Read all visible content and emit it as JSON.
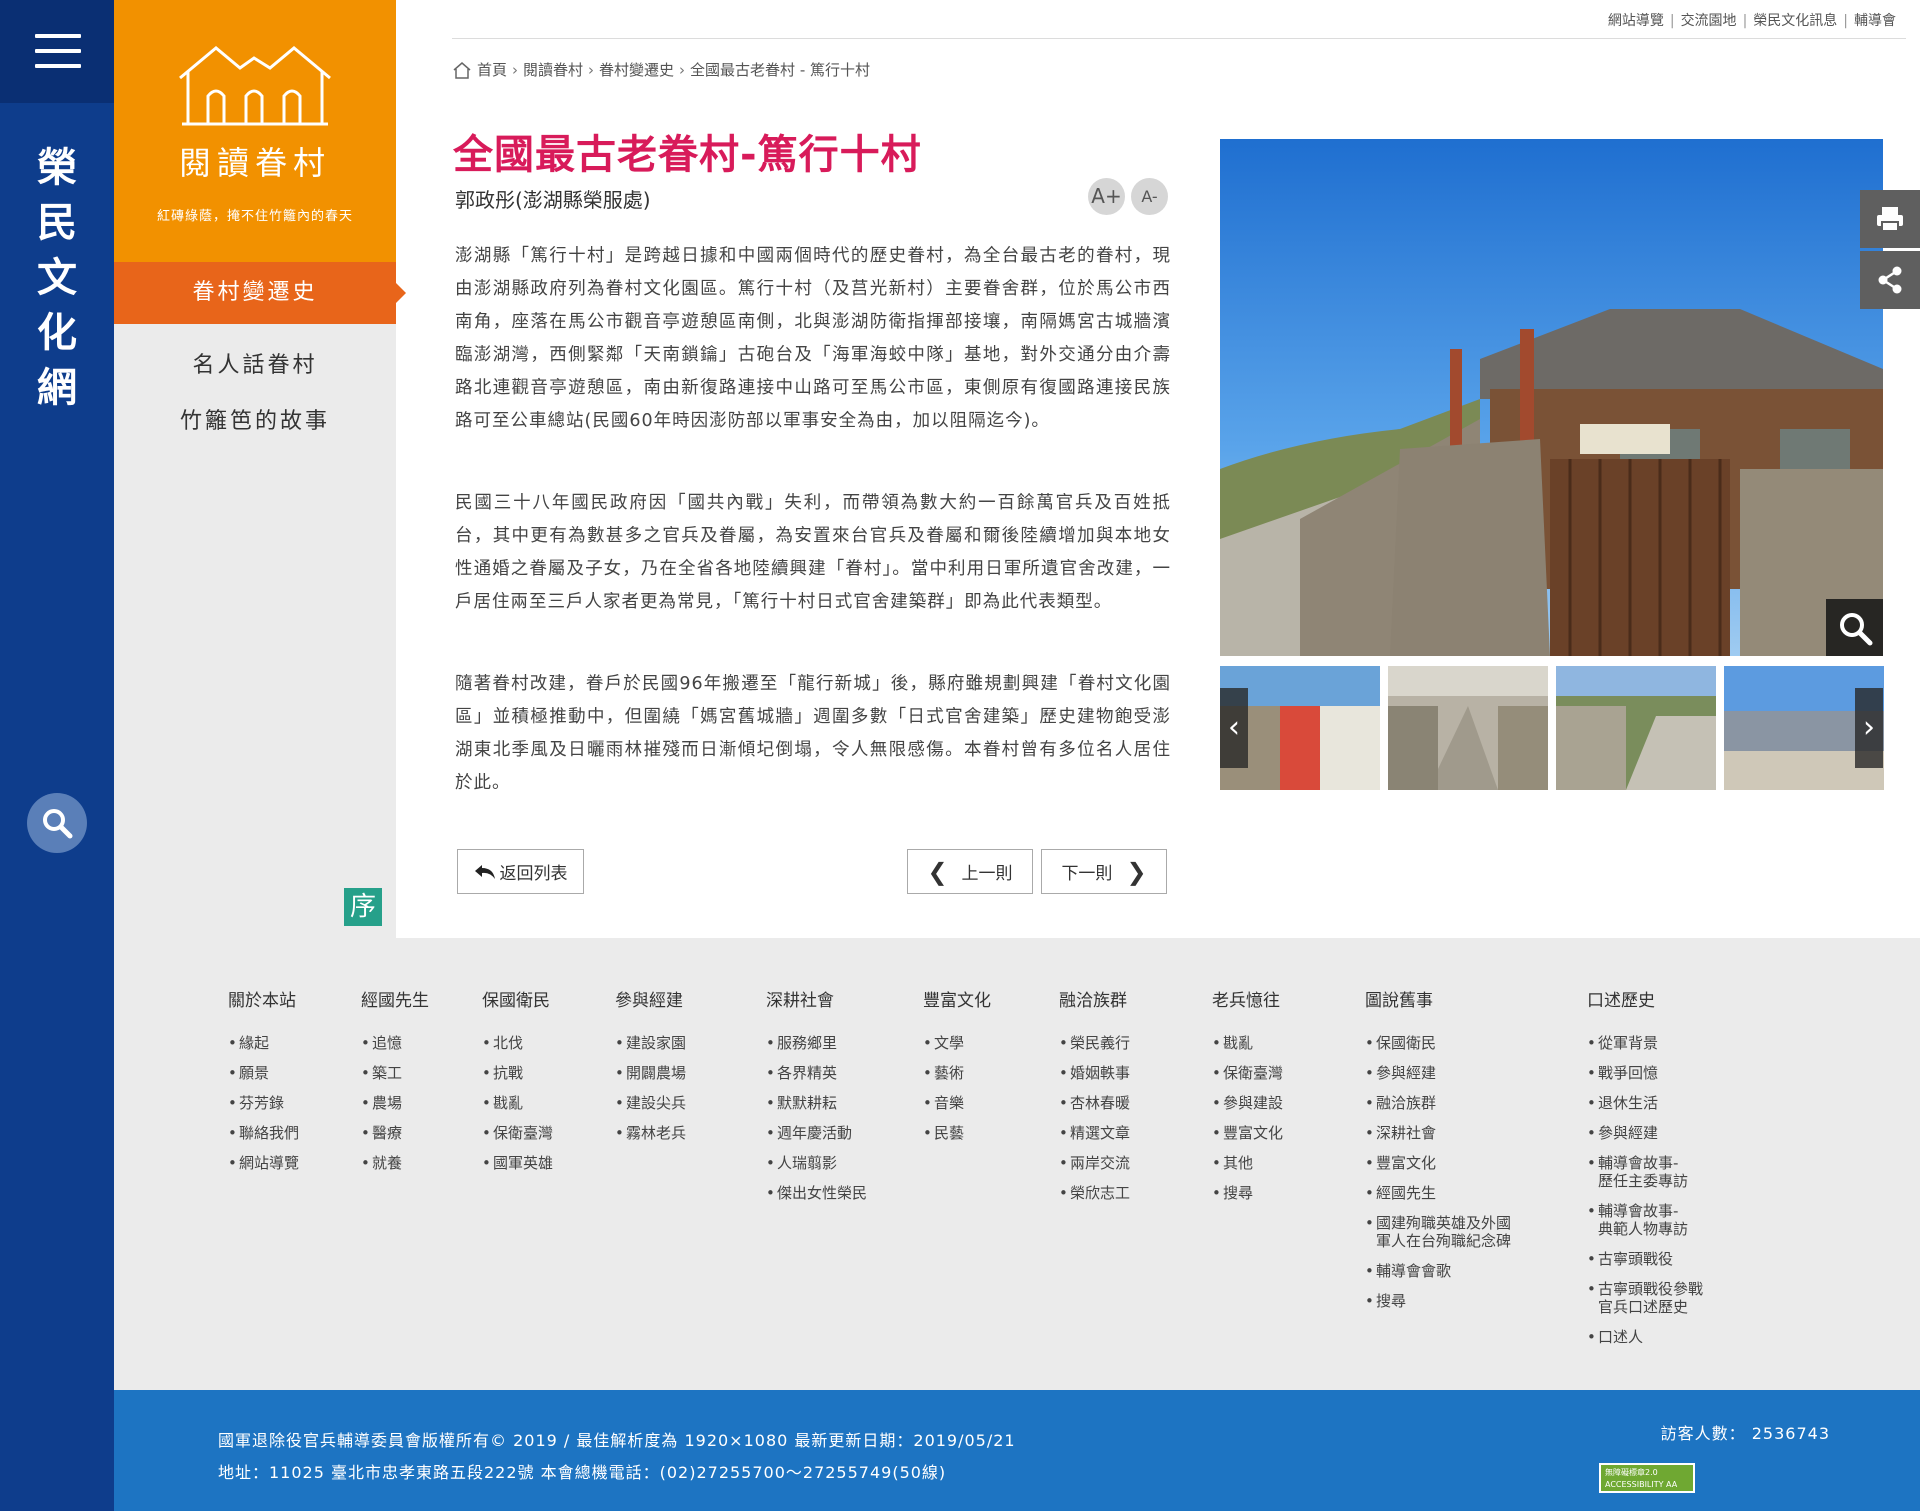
{
  "site": {
    "name": [
      "榮",
      "民",
      "文",
      "化",
      "網"
    ]
  },
  "sidebar": {
    "title": "閱讀眷村",
    "subtitle": "紅磚綠蔭，掩不住竹籬內的春天",
    "active": "眷村變遷史",
    "items": [
      "名人話眷村",
      "竹籬笆的故事"
    ],
    "badge": "序"
  },
  "toplinks": [
    "網站導覽",
    "交流園地",
    "榮民文化訊息",
    "輔導會"
  ],
  "breadcrumb": [
    "首頁",
    "閱讀眷村",
    "眷村變遷史",
    "全國最古老眷村 - 篤行十村"
  ],
  "article": {
    "title": "全國最古老眷村-篤行十村",
    "author": "郭政彤(澎湖縣榮服處)",
    "font_up": "A+",
    "font_down": "A-",
    "paragraphs": [
      "澎湖縣「篤行十村」是跨越日據和中國兩個時代的歷史眷村，為全台最古老的眷村，現由澎湖縣政府列為眷村文化園區。篤行十村（及莒光新村）主要眷舍群，位於馬公市西南角，座落在馬公市觀音亭遊憩區南側，北與澎湖防衛指揮部接壤，南隔媽宮古城牆濱臨澎湖灣，西側緊鄰「天南鎖鑰」古砲台及「海軍海蛟中隊」基地，對外交通分由介壽路北連觀音亭遊憩區，南由新復路連接中山路可至馬公市區，東側原有復國路連接民族路可至公車總站(民國60年時因澎防部以軍事安全為由，加以阻隔迄今)。",
      "民國三十八年國民政府因「國共內戰」失利，而帶領為數大約一百餘萬官兵及百姓抵台，其中更有為數甚多之官兵及眷屬，為安置來台官兵及眷屬和爾後陸續增加與本地女性通婚之眷屬及子女，乃在全省各地陸續興建「眷村」。當中利用日軍所遺官舍改建，一戶居住兩至三戶人家者更為常見，「篤行十村日式官舍建築群」即為此代表類型。",
      "隨著眷村改建，眷戶於民國96年搬遷至「龍行新城」後，縣府雖規劃興建「眷村文化園區」並積極推動中，但圍繞「媽宮舊城牆」週圍多數「日式官舍建築」歷史建物飽受澎湖東北季風及日曬雨林摧殘而日漸傾圮倒塌，令人無限感傷。本眷村曾有多位名人居住於此。"
    ]
  },
  "nav": {
    "back": "返回列表",
    "prev": "上一則",
    "next": "下一則",
    "thumb_prev": "‹",
    "thumb_next": "›"
  },
  "footer_nav": [
    {
      "title": "關於本站",
      "items": [
        "緣起",
        "願景",
        "芬芳錄",
        "聯絡我們",
        "網站導覽"
      ]
    },
    {
      "title": "經國先生",
      "items": [
        "追憶",
        "築工",
        "農場",
        "醫療",
        "就養"
      ]
    },
    {
      "title": "保國衛民",
      "items": [
        "北伐",
        "抗戰",
        "戡亂",
        "保衛臺灣",
        "國軍英雄"
      ]
    },
    {
      "title": "參與經建",
      "items": [
        "建設家園",
        "開闢農場",
        "建設尖兵",
        "霧林老兵"
      ]
    },
    {
      "title": "深耕社會",
      "items": [
        "服務鄉里",
        "各界精英",
        "默默耕耘",
        "週年慶活動",
        "人瑞翦影",
        "傑出女性榮民"
      ]
    },
    {
      "title": "豐富文化",
      "items": [
        "文學",
        "藝術",
        "音樂",
        "民藝"
      ]
    },
    {
      "title": "融洽族群",
      "items": [
        "榮民義行",
        "婚姻軼事",
        "杏林春暖",
        "精選文章",
        "兩岸交流",
        "榮欣志工"
      ]
    },
    {
      "title": "老兵憶往",
      "items": [
        "戡亂",
        "保衛臺灣",
        "參與建設",
        "豐富文化",
        "其他",
        "搜尋"
      ]
    },
    {
      "title": "圖說舊事",
      "items": [
        "保國衛民",
        "參與經建",
        "融洽族群",
        "深耕社會",
        "豐富文化",
        "經國先生",
        "國建殉職英雄及外國\n軍人在台殉職紀念碑",
        "輔導會會歌",
        "搜尋"
      ]
    },
    {
      "title": "口述歷史",
      "items": [
        "從軍背景",
        "戰爭回憶",
        "退休生活",
        "參與經建",
        "輔導會故事-\n歷任主委專訪",
        "輔導會故事-\n典範人物專訪",
        "古寧頭戰役",
        "古寧頭戰役參戰\n官兵口述歷史",
        "口述人"
      ]
    }
  ],
  "footer": {
    "line1": "國軍退除役官兵輔導委員會版權所有© 2019 / 最佳解析度為 1920×1080  最新更新日期：2019/05/21",
    "line2": "地址：11025 臺北市忠孝東路五段222號   本會總機電話：(02)27255700～27255749(50線)",
    "visitor_label": "訪客人數：",
    "visitor_count": "2536743",
    "a11y_badge": "無障礙標章2.0 ACCESSIBILITY AA"
  },
  "colors": {
    "rail": "#0e3d8c",
    "orange": "#f29100",
    "active": "#e8651a",
    "title": "#d81b5a",
    "footer": "#1d74c2"
  }
}
